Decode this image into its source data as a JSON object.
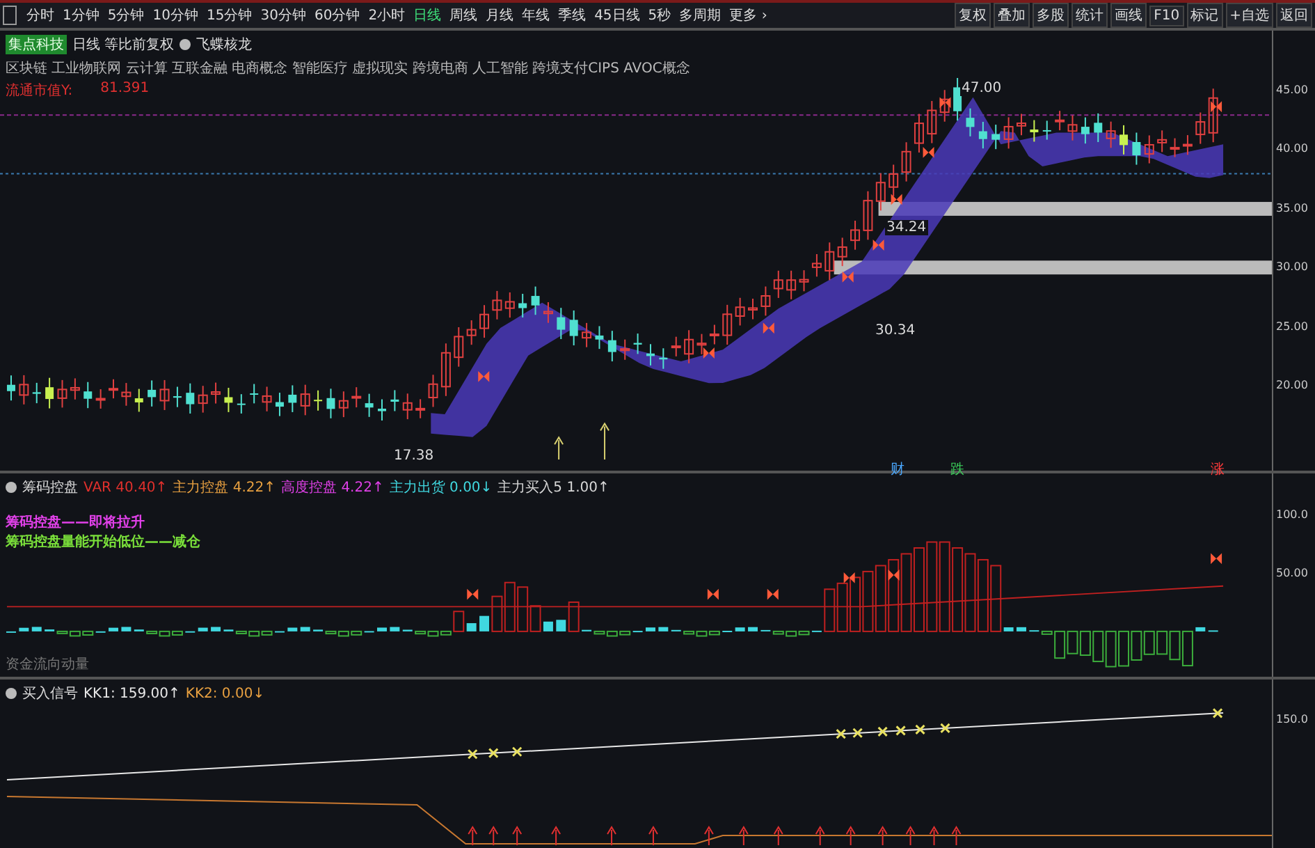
{
  "toolbar": {
    "periods": [
      {
        "label": "分时",
        "selected": false
      },
      {
        "label": "1分钟",
        "selected": false
      },
      {
        "label": "5分钟",
        "selected": false
      },
      {
        "label": "10分钟",
        "selected": false
      },
      {
        "label": "15分钟",
        "selected": false
      },
      {
        "label": "30分钟",
        "selected": false
      },
      {
        "label": "60分钟",
        "selected": false
      },
      {
        "label": "2小时",
        "selected": false
      },
      {
        "label": "日线",
        "selected": true
      },
      {
        "label": "周线",
        "selected": false
      },
      {
        "label": "月线",
        "selected": false
      },
      {
        "label": "年线",
        "selected": false
      },
      {
        "label": "季线",
        "selected": false
      },
      {
        "label": "45日线",
        "selected": false
      },
      {
        "label": "5秒",
        "selected": false
      },
      {
        "label": "多周期",
        "selected": false
      },
      {
        "label": "更多 ›",
        "selected": false
      }
    ],
    "buttons": [
      "复权",
      "叠加",
      "多股",
      "统计",
      "画线",
      "F10",
      "标记",
      "+自选",
      "返回"
    ]
  },
  "main_panel": {
    "stock_name": "集点科技",
    "mode": "日线 等比前复权",
    "indicator": "飞蝶核龙",
    "concepts": "区块链 工业物联网 云计算 互联金融 电商概念 智能医疗 虚拟现实 跨境电商 人工智能 跨境支付CIPS AVOC概念",
    "market_cap_label": "流通市值Y:",
    "market_cap_value": "81.391",
    "price_axis": [
      "45.00",
      "40.00",
      "35.00",
      "30.00",
      "25.00",
      "20.00"
    ],
    "annotations": [
      "47.00",
      "34.24",
      "30.34",
      "17.38"
    ],
    "event_labels": [
      {
        "text": "财",
        "color": "#4aa8ff"
      },
      {
        "text": "跌",
        "color": "#3ccf5a"
      },
      {
        "text": "涨",
        "color": "#ff3b3b"
      }
    ]
  },
  "control_panel": {
    "title": "筹码控盘",
    "readings": [
      {
        "text": "VAR 40.40↑",
        "color": "#e0302c"
      },
      {
        "text": "主力控盘 4.22↑",
        "color": "#e8a040"
      },
      {
        "text": "高度控盘 4.22↑",
        "color": "#e040e8"
      },
      {
        "text": "主力出货 0.00↓",
        "color": "#40d8e0"
      },
      {
        "text": "主力买入5 1.00↑",
        "color": "#d8d8d8"
      }
    ],
    "notes": [
      {
        "text": "筹码控盘——即将拉升",
        "color": "#e040e8"
      },
      {
        "text": "筹码控盘量能开始低位——减仓",
        "color": "#7adf3a"
      }
    ],
    "axis": [
      "100.0",
      "50.00"
    ],
    "footer": "资金流向动量"
  },
  "signal_panel": {
    "title": "买入信号",
    "readings": [
      {
        "text": "KK1: 159.00↑",
        "color": "#e8e8e8"
      },
      {
        "text": "KK2: 0.00↓",
        "color": "#e8a040"
      }
    ],
    "axis": [
      "150.0"
    ]
  }
}
